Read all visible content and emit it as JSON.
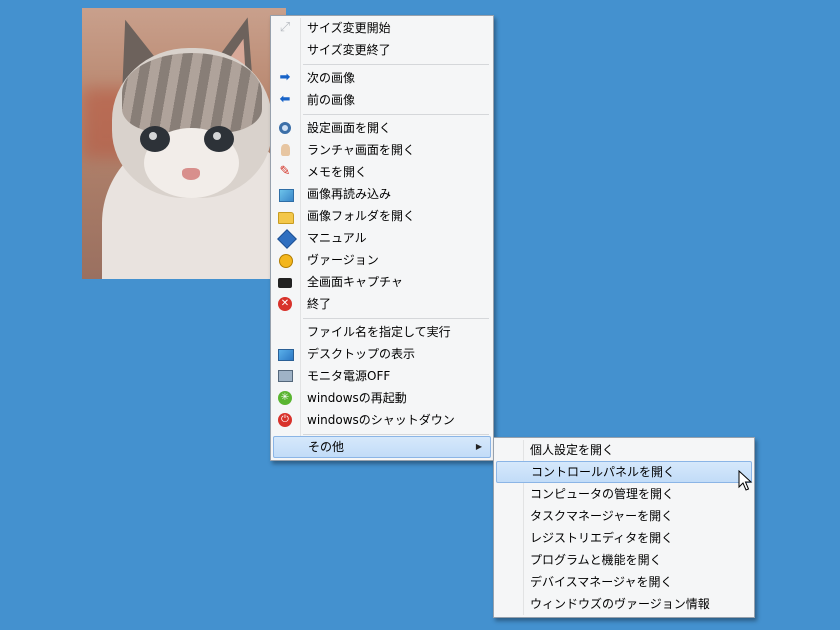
{
  "main_menu": {
    "groups": [
      [
        {
          "label": "サイズ変更開始",
          "icon": "resize-icon"
        },
        {
          "label": "サイズ変更終了",
          "icon": ""
        }
      ],
      [
        {
          "label": "次の画像",
          "icon": "arrow-right-icon"
        },
        {
          "label": "前の画像",
          "icon": "arrow-left-icon"
        }
      ],
      [
        {
          "label": "設定画面を開く",
          "icon": "gear-icon"
        },
        {
          "label": "ランチャ画面を開く",
          "icon": "launcher-icon"
        },
        {
          "label": "メモを開く",
          "icon": "pen-icon"
        },
        {
          "label": "画像再読み込み",
          "icon": "reload-image-icon"
        },
        {
          "label": "画像フォルダを開く",
          "icon": "folder-icon"
        },
        {
          "label": "マニュアル",
          "icon": "book-icon"
        },
        {
          "label": "ヴァージョン",
          "icon": "smiley-icon"
        },
        {
          "label": "全画面キャプチャ",
          "icon": "camera-icon"
        },
        {
          "label": "終了",
          "icon": "close-icon"
        }
      ],
      [
        {
          "label": "ファイル名を指定して実行",
          "icon": ""
        },
        {
          "label": "デスクトップの表示",
          "icon": "desktop-icon"
        },
        {
          "label": "モニタ電源OFF",
          "icon": "monitor-icon"
        },
        {
          "label": "windowsの再起動",
          "icon": "restart-icon"
        },
        {
          "label": "windowsのシャットダウン",
          "icon": "power-icon"
        }
      ]
    ],
    "other": {
      "label": "その他",
      "submenu_arrow": "▶"
    }
  },
  "sub_menu": {
    "items": [
      {
        "label": "個人設定を開く"
      },
      {
        "label": "コントロールパネルを開く"
      },
      {
        "label": "コンピュータの管理を開く"
      },
      {
        "label": "タスクマネージャーを開く"
      },
      {
        "label": "レジストリエディタを開く"
      },
      {
        "label": "プログラムと機能を開く"
      },
      {
        "label": "デバイスマネージャを開く"
      },
      {
        "label": "ウィンドウズのヴァージョン情報"
      }
    ],
    "highlighted_index": 1
  },
  "glyphs": {
    "resize": "⤢",
    "arrow_right": "➡",
    "arrow_left": "⬅",
    "pen": "✎",
    "close": "✕",
    "restart": "✳",
    "power": "⏻"
  },
  "colors": {
    "desktop_bg": "#4491cf",
    "menu_bg": "#f5f6f7",
    "highlight": "#c2dcf8",
    "highlight_border": "#8bb5e6"
  }
}
